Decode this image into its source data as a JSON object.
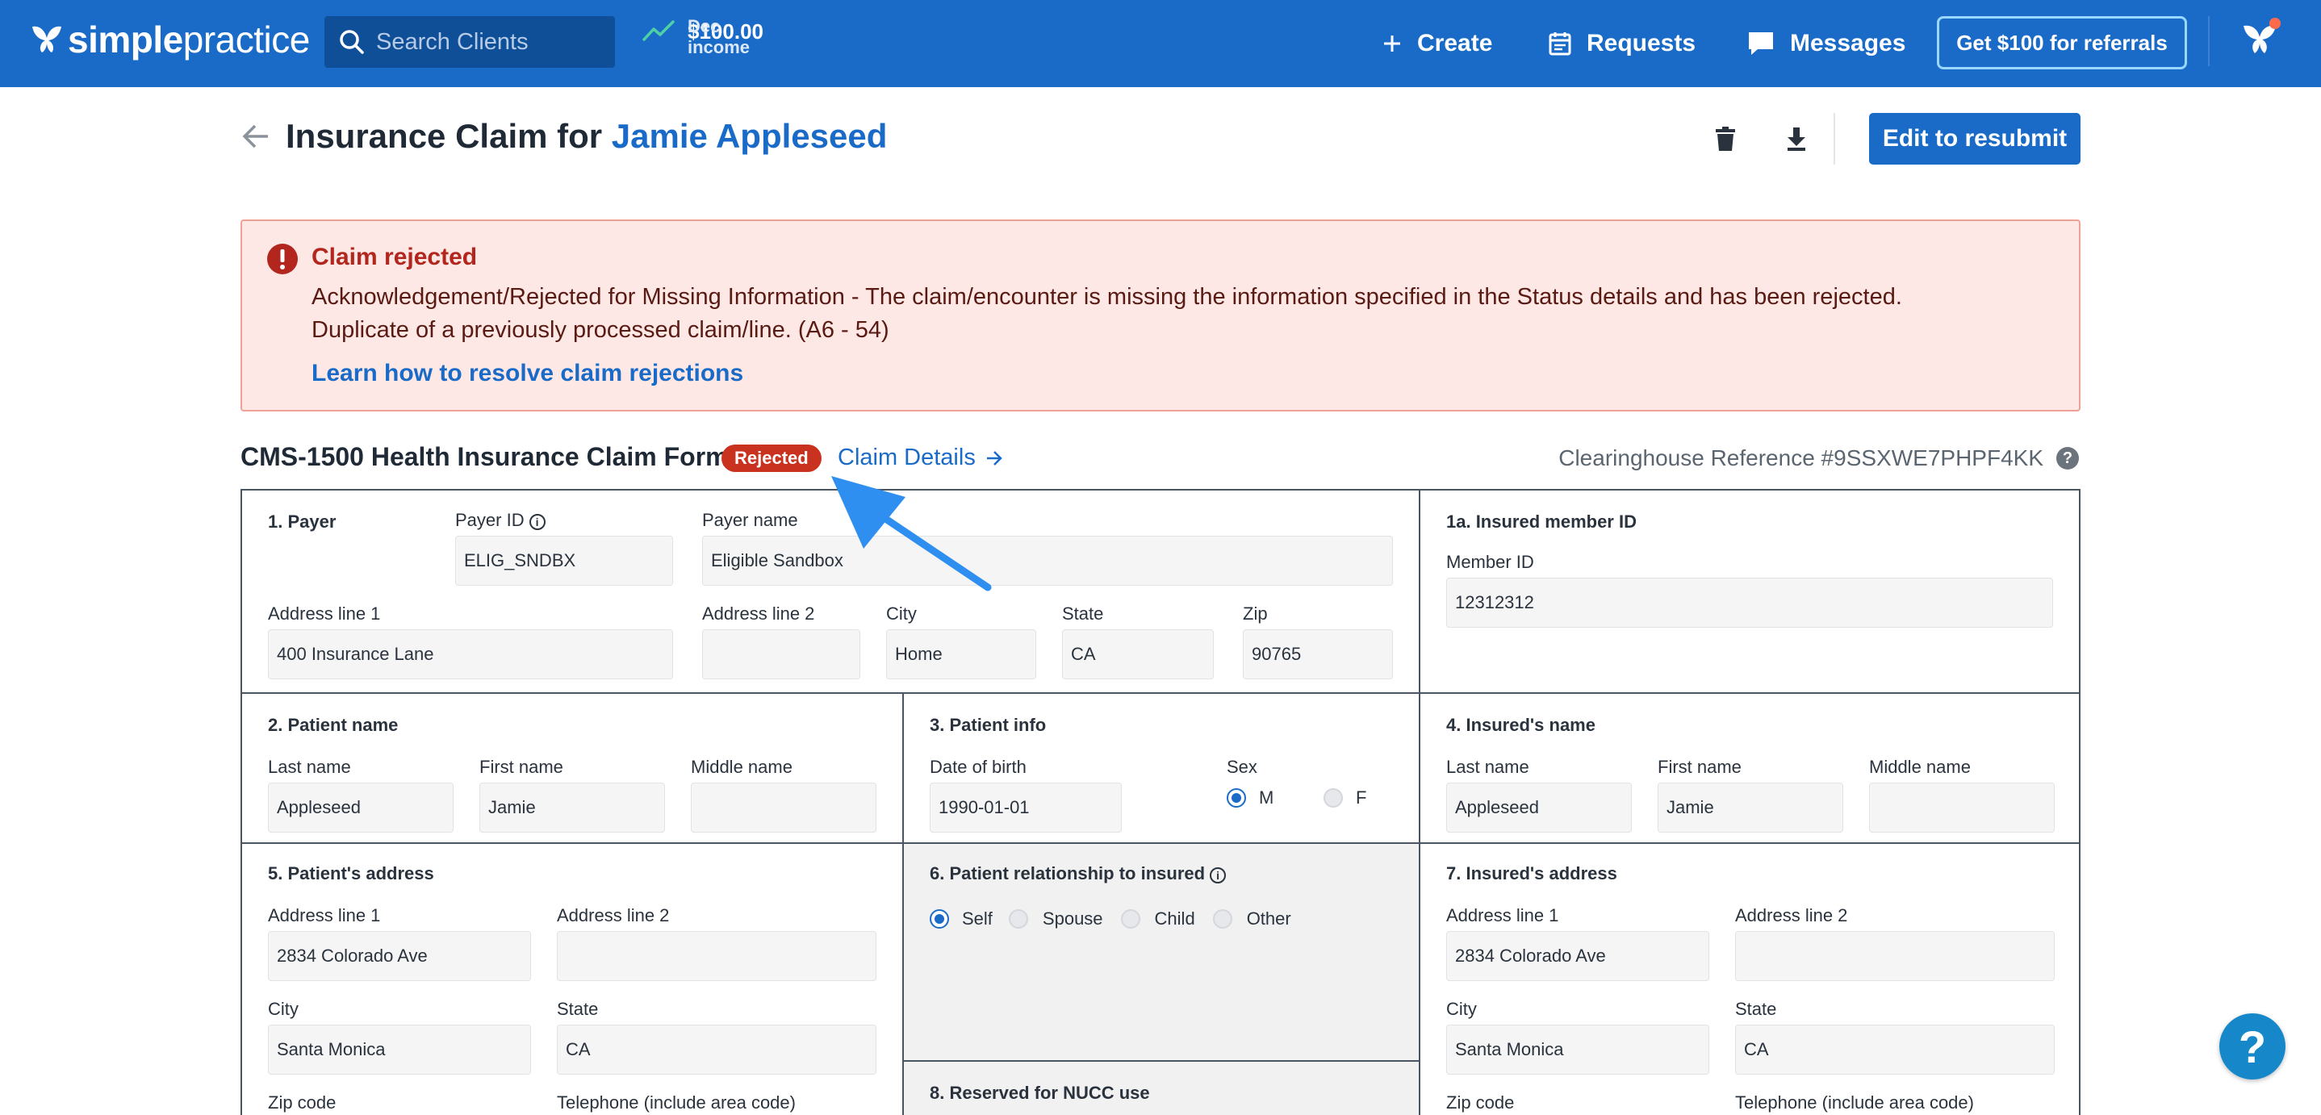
{
  "nav": {
    "logo_bold": "simple",
    "logo_light": "practice",
    "search_placeholder": "Search Clients",
    "income_label": "Dec income",
    "income_value": "$100.00",
    "create": "Create",
    "requests": "Requests",
    "messages": "Messages",
    "referral": "Get $100 for referrals"
  },
  "header": {
    "title_prefix": "Insurance Claim for ",
    "client_name": "Jamie Appleseed",
    "resubmit": "Edit to resubmit"
  },
  "alert": {
    "title": "Claim rejected",
    "line1": "Acknowledgement/Rejected for Missing Information - The claim/encounter is missing the information specified in the Status details and has been rejected.",
    "line2": "Duplicate of a previously processed claim/line. (A6 - 54)",
    "link": "Learn how to resolve claim rejections"
  },
  "form_header": {
    "title": "CMS-1500 Health Insurance Claim Form",
    "badge": "Rejected",
    "claim_details": "Claim Details",
    "clearinghouse": "Clearinghouse Reference #9SSXWE7PHPF4KK"
  },
  "payer": {
    "section": "1. Payer",
    "payer_id_label": "Payer ID",
    "payer_id": "ELIG_SNDBX",
    "payer_name_label": "Payer name",
    "payer_name": "Eligible Sandbox",
    "addr1_label": "Address line 1",
    "addr1": "400 Insurance Lane",
    "addr2_label": "Address line 2",
    "addr2": "",
    "city_label": "City",
    "city": "Home",
    "state_label": "State",
    "state": "CA",
    "zip_label": "Zip",
    "zip": "90765"
  },
  "insured_id": {
    "section": "1a. Insured member ID",
    "member_label": "Member ID",
    "member": "12312312"
  },
  "patient_name": {
    "section": "2. Patient name",
    "last_label": "Last name",
    "last": "Appleseed",
    "first_label": "First name",
    "first": "Jamie",
    "middle_label": "Middle name",
    "middle": ""
  },
  "patient_info": {
    "section": "3. Patient info",
    "dob_label": "Date of birth",
    "dob": "1990-01-01",
    "sex_label": "Sex",
    "sex_m": "M",
    "sex_f": "F"
  },
  "insured_name": {
    "section": "4. Insured's name",
    "last_label": "Last name",
    "last": "Appleseed",
    "first_label": "First name",
    "first": "Jamie",
    "middle_label": "Middle name",
    "middle": ""
  },
  "patient_address": {
    "section": "5. Patient's address",
    "addr1_label": "Address line 1",
    "addr1": "2834 Colorado Ave",
    "addr2_label": "Address line 2",
    "addr2": "",
    "city_label": "City",
    "city": "Santa Monica",
    "state_label": "State",
    "state": "CA",
    "zip_label": "Zip code",
    "phone_label": "Telephone (include area code)"
  },
  "relationship": {
    "section": "6. Patient relationship to insured",
    "self": "Self",
    "spouse": "Spouse",
    "child": "Child",
    "other": "Other"
  },
  "reserved": {
    "section": "8. Reserved for NUCC use"
  },
  "insured_address": {
    "section": "7. Insured's address",
    "addr1_label": "Address line 1",
    "addr1": "2834 Colorado Ave",
    "addr2_label": "Address line 2",
    "addr2": "",
    "city_label": "City",
    "city": "Santa Monica",
    "state_label": "State",
    "state": "CA",
    "zip_label": "Zip code",
    "phone_label": "Telephone (include area code)"
  },
  "help_button": "?",
  "colors": {
    "brand": "#1a6bc8",
    "reject": "#c8321e",
    "alert_bg": "#fde8e5",
    "annotation_arrow": "#2e8ff0"
  }
}
